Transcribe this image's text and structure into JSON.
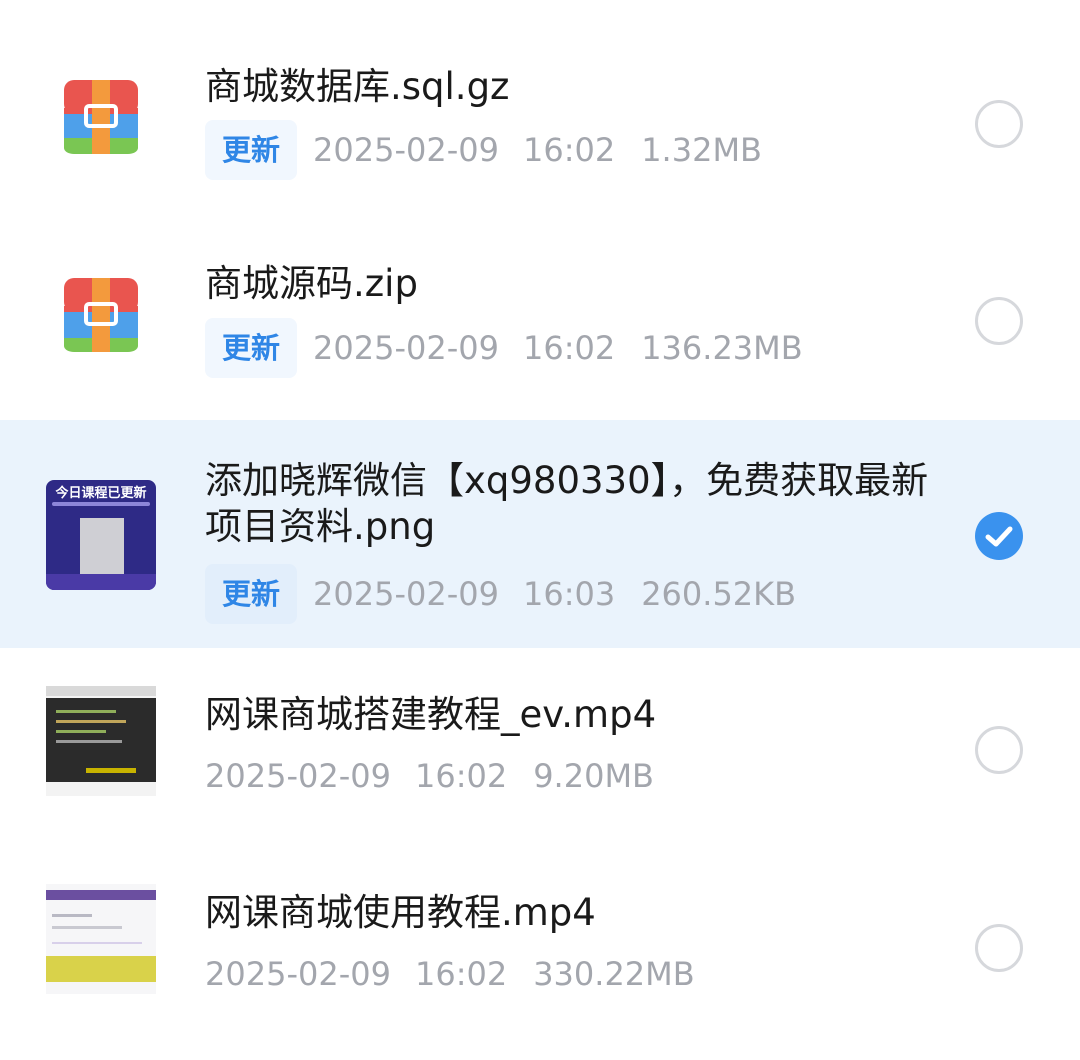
{
  "files": [
    {
      "name": "商城数据库.sql.gz",
      "badge": "更新",
      "date": "2025-02-09",
      "time": "16:02",
      "size": "1.32MB",
      "icon": "archive-icon",
      "selected": false
    },
    {
      "name": "商城源码.zip",
      "badge": "更新",
      "date": "2025-02-09",
      "time": "16:02",
      "size": "136.23MB",
      "icon": "archive-icon",
      "selected": false
    },
    {
      "name": "添加晓辉微信【xq980330】，免费获取最新项目资料.png",
      "badge": "更新",
      "date": "2025-02-09",
      "time": "16:03",
      "size": "260.52KB",
      "icon": "image-thumbnail",
      "thumb_caption": "今日课程已更新",
      "selected": true
    },
    {
      "name": "网课商城搭建教程_ev.mp4",
      "date": "2025-02-09",
      "time": "16:02",
      "size": "9.20MB",
      "icon": "video-thumbnail",
      "selected": false
    },
    {
      "name": "网课商城使用教程.mp4",
      "date": "2025-02-09",
      "time": "16:02",
      "size": "330.22MB",
      "icon": "video-thumbnail",
      "selected": false
    }
  ],
  "colors": {
    "accent": "#3a92ee",
    "badge_text": "#2f86e6",
    "selected_row_bg": "#eaf3fc",
    "meta_text": "#a3a6ad"
  }
}
